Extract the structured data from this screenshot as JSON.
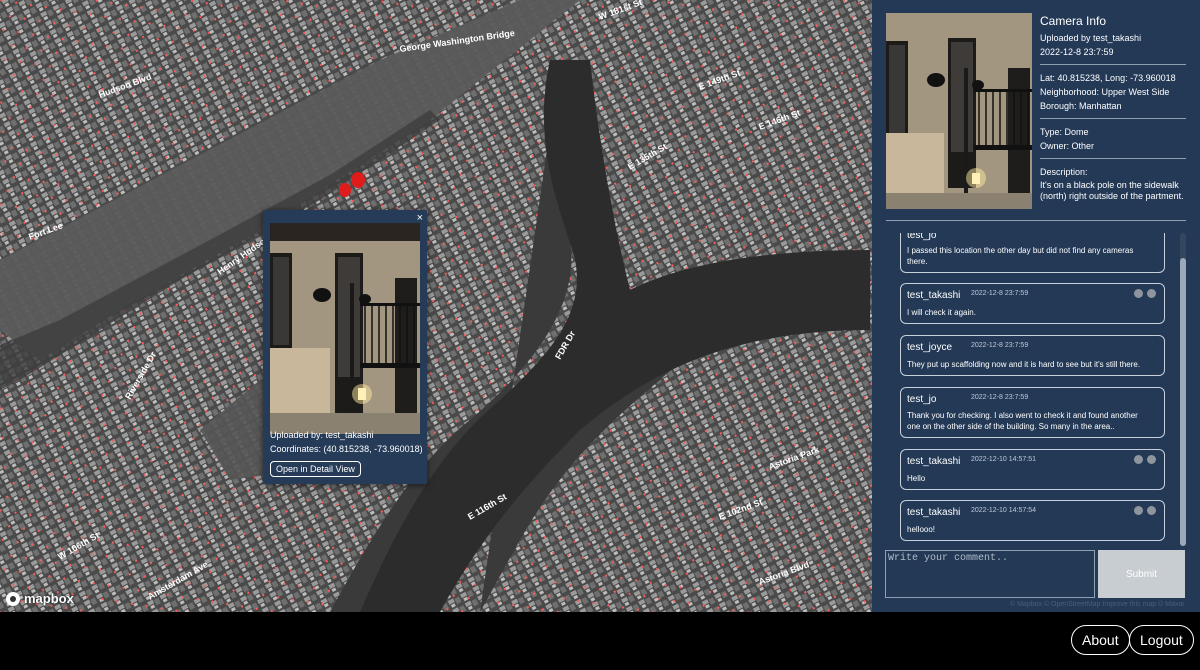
{
  "map": {
    "logo_text": "mapbox",
    "attribution": "© Mapbox © OpenStreetMap Improve this map © Maxar",
    "colors": {
      "marker": "#e01b1b",
      "popup_bg": "#253b58"
    }
  },
  "popup": {
    "close_label": "×",
    "uploaded_by": "Uploaded by: test_takashi",
    "coordinates": "Coordinates: (40.815238, -73.960018)",
    "detail_button": "Open in Detail View"
  },
  "camera_info": {
    "title": "Camera Info",
    "uploaded_by": "Uploaded by test_takashi",
    "date": "2022-12-8 23:7:59",
    "lat_long": "Lat: 40.815238, Long: -73.960018",
    "neighborhood": "Neighborhood: Upper West Side",
    "borough": "Borough: Manhattan",
    "type": "Type: Dome",
    "owner": "Owner: Other",
    "description_label": "Description:",
    "description_line1": "It's on a black pole on the sidewalk",
    "description_line2": "(north) right outside of the partment."
  },
  "comments": [
    {
      "user": "test_jo",
      "date": "",
      "line1": "I passed this location the other day but did not find any cameras",
      "line2": "there.",
      "editable": false
    },
    {
      "user": "test_takashi",
      "date": "2022-12-8 23:7:59",
      "line1": "I will check it again.",
      "line2": "",
      "editable": true
    },
    {
      "user": "test_joyce",
      "date": "2022-12-8 23:7:59",
      "line1": "They put up scaffolding now and it is hard to see but it's still there.",
      "line2": "",
      "editable": false
    },
    {
      "user": "test_jo",
      "date": "2022-12-8 23:7:59",
      "line1": "Thank you for checking. I also went to check it and found another",
      "line2": "one on the other side of the building. So many in the area..",
      "editable": false
    },
    {
      "user": "test_takashi",
      "date": "2022-12-10 14:57:51",
      "line1": "Hello",
      "line2": "",
      "editable": true
    },
    {
      "user": "test_takashi",
      "date": "2022-12-10 14:57:54",
      "line1": "hellooo!",
      "line2": "",
      "editable": true
    }
  ],
  "comment_form": {
    "placeholder": "Write your comment..",
    "submit_label": "Submit"
  },
  "footer": {
    "about_label": "About",
    "logout_label": "Logout"
  }
}
